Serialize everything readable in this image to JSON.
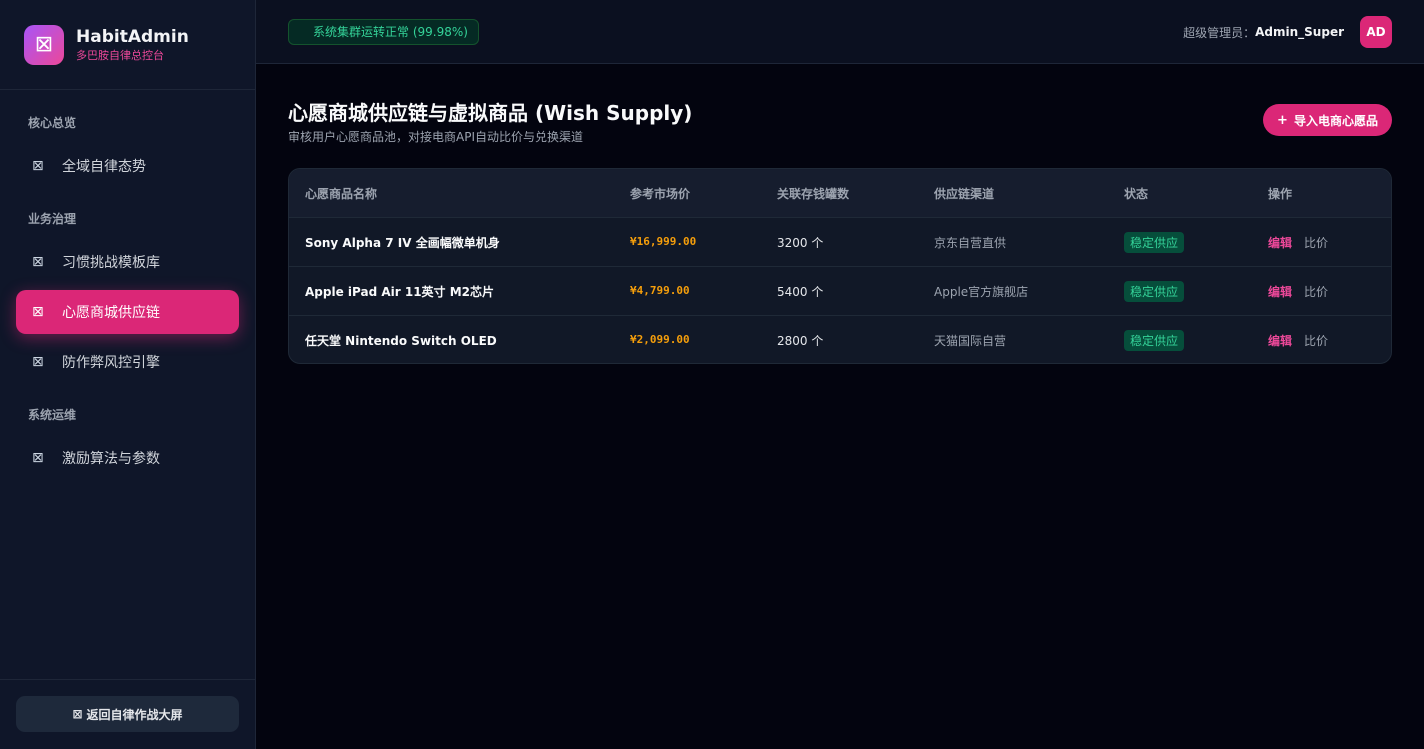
{
  "brand": {
    "name": "HabitAdmin",
    "subtitle": "多巴胺自律总控台"
  },
  "sidebar": {
    "sections": [
      {
        "title": "核心总览"
      },
      {
        "title": "业务治理"
      },
      {
        "title": "系统运维"
      }
    ],
    "items": [
      {
        "label": "全域自律态势"
      },
      {
        "label": "习惯挑战模板库"
      },
      {
        "label": "心愿商城供应链"
      },
      {
        "label": "防作弊风控引擎"
      },
      {
        "label": "激励算法与参数"
      }
    ],
    "footer_button": "返回自律作战大屏"
  },
  "topbar": {
    "status": "系统集群运转正常 (99.98%)",
    "admin_label": "超级管理员：",
    "admin_name": "Admin_Super",
    "avatar": "AD"
  },
  "page": {
    "title": "心愿商城供应链与虚拟商品 (Wish Supply)",
    "subtitle": "审核用户心愿商品池，对接电商API自动比价与兑换渠道",
    "import_button": "导入电商心愿品"
  },
  "table": {
    "headers": [
      "心愿商品名称",
      "参考市场价",
      "关联存钱罐数",
      "供应链渠道",
      "状态",
      "操作"
    ],
    "rows": [
      {
        "name": "Sony Alpha 7 IV 全画幅微单机身",
        "price": "¥16,999.00",
        "count": "3200 个",
        "channel": "京东自营直供",
        "status": "稳定供应",
        "edit": "编辑",
        "compare": "比价"
      },
      {
        "name": "Apple iPad Air 11英寸 M2芯片",
        "price": "¥4,799.00",
        "count": "5400 个",
        "channel": "Apple官方旗舰店",
        "status": "稳定供应",
        "edit": "编辑",
        "compare": "比价"
      },
      {
        "name": "任天堂 Nintendo Switch OLED",
        "price": "¥2,099.00",
        "count": "2800 个",
        "channel": "天猫国际自营",
        "status": "稳定供应",
        "edit": "编辑",
        "compare": "比价"
      }
    ]
  },
  "colors": {
    "accent": "#db2777",
    "success": "#34d399",
    "price": "#f59e0b"
  },
  "icons": {
    "placeholder": "⊠"
  }
}
